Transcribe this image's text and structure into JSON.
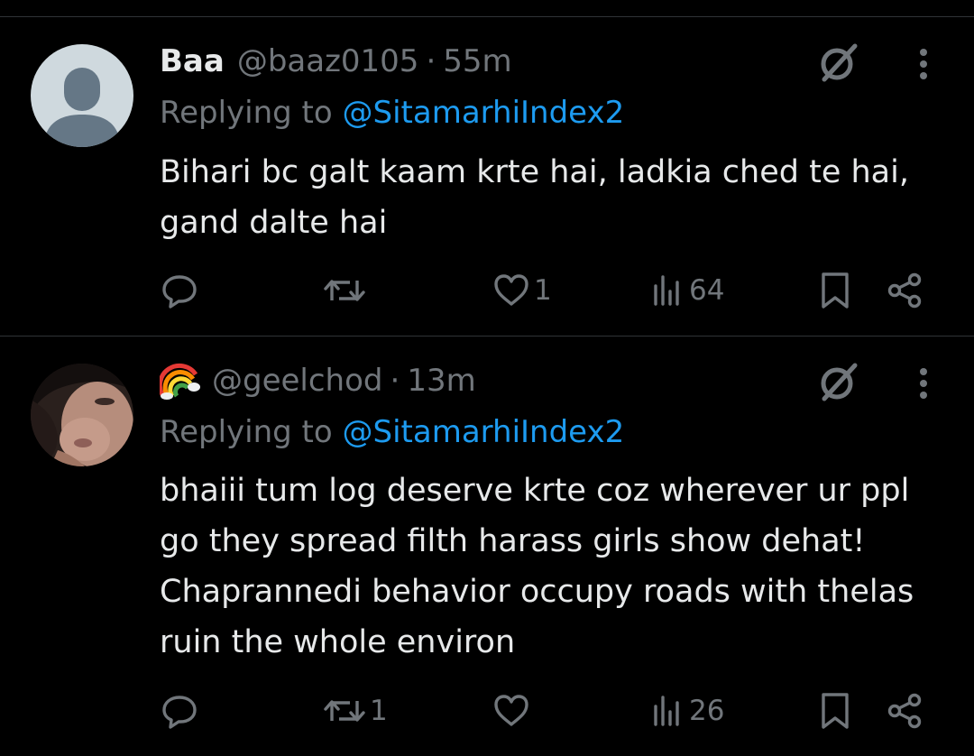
{
  "colors": {
    "background": "#000000",
    "text_primary": "#e7e9ea",
    "text_secondary": "#71767b",
    "link": "#1d9bf0",
    "divider": "#2f3336"
  },
  "tweets": [
    {
      "display_name": "Baa",
      "handle": "@baaz0105",
      "separator": "·",
      "time": "55m",
      "replying_prefix": "Replying to",
      "replying_to": "@SitamarhiIndex2",
      "text": "Bihari bc galt kaam krte hai, ladkia ched te hai, gand dalte hai",
      "avatar_icon": "default-avatar-icon",
      "name_icon": "",
      "actions": {
        "reply_count": "",
        "repost_count": "",
        "like_count": "1",
        "view_count": "64"
      }
    },
    {
      "display_name": "",
      "handle": "@geelchod",
      "separator": "·",
      "time": "13m",
      "replying_prefix": "Replying to",
      "replying_to": "@SitamarhiIndex2",
      "text": "bhaiii tum log deserve krte coz wherever ur ppl go they spread filth harass girls show dehat! Chaprannedi behavior occupy roads with thelas  ruin the whole environ",
      "avatar_icon": "profile-photo",
      "name_icon": "rainbow-emoji",
      "actions": {
        "reply_count": "",
        "repost_count": "1",
        "like_count": "",
        "view_count": "26"
      }
    }
  ]
}
